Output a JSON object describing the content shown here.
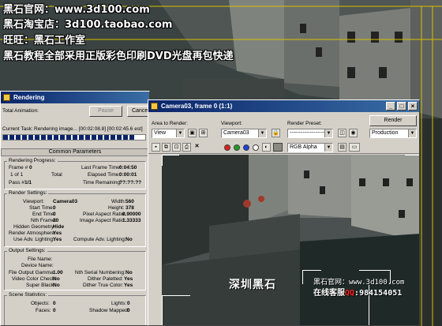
{
  "overlay": {
    "line1": "黑石官网：www.3d100.com",
    "line2": "黑石淘宝店：3d100.taobao.com",
    "line3": "旺旺：黑石工作室",
    "line4": "黑石教程全部采用正版彩色印刷DVD光盘再包快递"
  },
  "render_dialog": {
    "title": "Rendering",
    "total_animation_label": "Total Animation:",
    "pause_label": "Pause",
    "cancel_label": "Cancel",
    "current_task_label": "Current Task:",
    "current_task_value": "Rendering image... [00:02:08.8] [00:02:45.6 est]",
    "progress": 0.93,
    "common_parameters_label": "Common Parameters",
    "rendering_progress": {
      "title": "Rendering Progress:",
      "frame_label": "Frame #",
      "frame_value": "0",
      "of_value": "1 of 1",
      "total_label": "Total",
      "pass_label": "Pass #",
      "pass_value": "1/1",
      "last_frame_time_label": "Last Frame Time:",
      "last_frame_time_value": "0:04:50",
      "elapsed_time_label": "Elapsed Time:",
      "elapsed_time_value": "0:00:01",
      "time_remaining_label": "Time Remaining:",
      "time_remaining_value": "??:??:??"
    },
    "render_settings": {
      "title": "Render Settings:",
      "viewport_label": "Viewport:",
      "viewport_value": "Camera03",
      "width_label": "Width:",
      "width_value": "560",
      "start_time_label": "Start Time:",
      "start_time_value": "0",
      "height_label": "Height:",
      "height_value": "378",
      "end_time_label": "End Time:",
      "end_time_value": "0",
      "pixel_aspect_label": "Pixel Aspect Ratio:",
      "pixel_aspect_value": "0.90000",
      "nth_frame_label": "Nth Frame:",
      "nth_frame_value": "30",
      "image_aspect_label": "Image Aspect Ratio:",
      "image_aspect_value": "1.33333",
      "hidden_geometry_label": "Hidden Geometry:",
      "hidden_geometry_value": "Hide",
      "render_atmosphere_label": "Render Atmosphere:",
      "render_atmosphere_value": "Yes",
      "use_adv_lighting_label": "Use Adv. Lighting:",
      "use_adv_lighting_value": "Yes",
      "compute_adv_lighting_label": "Compute Adv. Lighting:",
      "compute_adv_lighting_value": "No"
    },
    "output_settings": {
      "title": "Output Settings:",
      "file_name_label": "File Name:",
      "device_name_label": "Device Name:",
      "file_output_gamma_label": "File Output Gamma:",
      "file_output_gamma_value": "1.00",
      "nth_serial_label": "Nth Serial Numbering:",
      "nth_serial_value": "No",
      "video_color_check_label": "Video Color Check:",
      "video_color_check_value": "No",
      "dither_paletted_label": "Dither Paletted:",
      "dither_paletted_value": "Yes",
      "super_black_label": "Super Black:",
      "super_black_value": "No",
      "dither_true_color_label": "Dither True Color:",
      "dither_true_color_value": "Yes"
    },
    "scene_statistics": {
      "title": "Scene Statistics:",
      "objects_label": "Objects:",
      "objects_value": "0",
      "lights_label": "Lights:",
      "lights_value": "0",
      "faces_label": "Faces:",
      "faces_value": "0",
      "shadow_mapped_label": "Shadow Mapped:",
      "shadow_mapped_value": "0"
    }
  },
  "frame_window": {
    "title": "Camera03, frame 0 (1:1)",
    "area_to_render_label": "Area to Render:",
    "area_to_render_value": "View",
    "viewport_label": "Viewport:",
    "viewport_value": "Camera03",
    "render_preset_label": "Render Preset:",
    "render_preset_value": "--------------------",
    "render_button_label": "Render",
    "mode_value": "Production",
    "channel_value": "RGB Alpha"
  },
  "watermark": {
    "brand": "深圳黑石",
    "site": "黑石官网：www.3d100.com",
    "service_prefix": "在线客服",
    "qq_label": "QQ",
    "qq_number": ":984154051"
  },
  "colors": {
    "title_bar": "#0a246a",
    "dialog_face": "#d4d0c8",
    "qq_red": "#ff2020"
  }
}
